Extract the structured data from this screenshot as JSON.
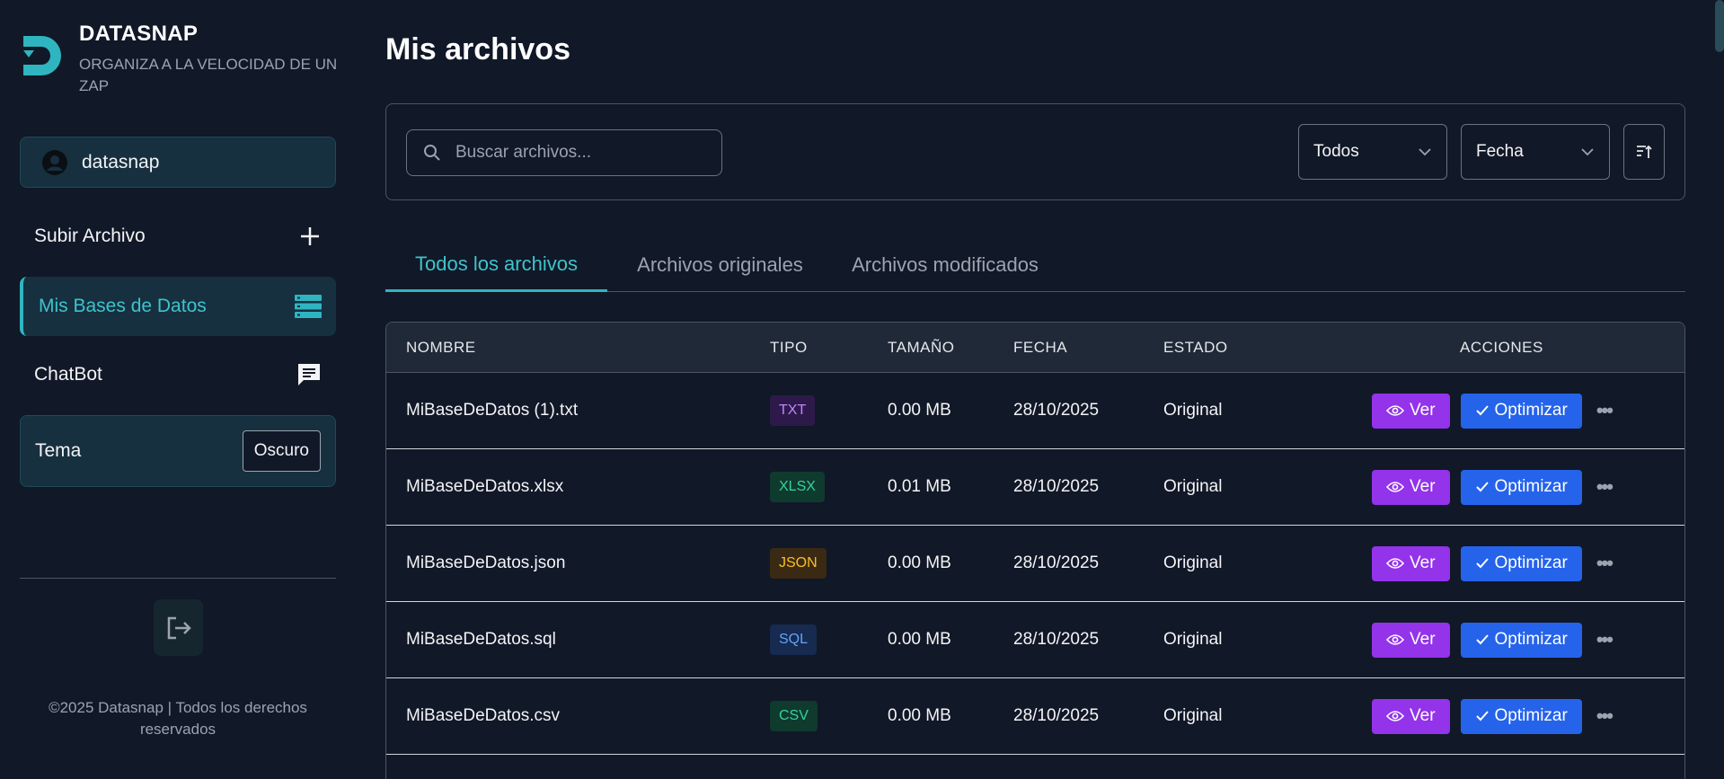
{
  "brand": {
    "name": "DATASNAP",
    "tagline": "ORGANIZA A LA VELOCIDAD DE UN ZAP"
  },
  "user": {
    "name": "datasnap"
  },
  "nav": {
    "upload": "Subir Archivo",
    "databases": "Mis Bases de Datos",
    "chatbot": "ChatBot"
  },
  "theme": {
    "label": "Tema",
    "value": "Oscuro"
  },
  "footer": "©2025 Datasnap | Todos los derechos reservados",
  "main": {
    "title": "Mis archivos",
    "search_placeholder": "Buscar archivos...",
    "filter_type": "Todos",
    "sort_by": "Fecha",
    "tabs": [
      "Todos los archivos",
      "Archivos originales",
      "Archivos modificados"
    ]
  },
  "table": {
    "headers": [
      "NOMBRE",
      "TIPO",
      "TAMAÑO",
      "FECHA",
      "ESTADO",
      "ACCIONES"
    ],
    "view_label": "Ver",
    "optimize_label": "Optimizar",
    "more_label": "•••",
    "rows": [
      {
        "name": "MiBaseDeDatos (1).txt",
        "type": "TXT",
        "size": "0.00 MB",
        "date": "28/10/2025",
        "state": "Original"
      },
      {
        "name": "MiBaseDeDatos.xlsx",
        "type": "XLSX",
        "size": "0.01 MB",
        "date": "28/10/2025",
        "state": "Original"
      },
      {
        "name": "MiBaseDeDatos.json",
        "type": "JSON",
        "size": "0.00 MB",
        "date": "28/10/2025",
        "state": "Original"
      },
      {
        "name": "MiBaseDeDatos.sql",
        "type": "SQL",
        "size": "0.00 MB",
        "date": "28/10/2025",
        "state": "Original"
      },
      {
        "name": "MiBaseDeDatos.csv",
        "type": "CSV",
        "size": "0.00 MB",
        "date": "28/10/2025",
        "state": "Original"
      }
    ]
  },
  "colors": {
    "accent": "#2fb5c0",
    "txt": {
      "fg": "#c084fc",
      "bg": "#2e1a4a"
    },
    "xlsx": {
      "fg": "#34d399",
      "bg": "#0f3a2e"
    },
    "json": {
      "fg": "#fbbf24",
      "bg": "#3a2a14"
    },
    "sql": {
      "fg": "#60a5fa",
      "bg": "#172a4f"
    },
    "csv": {
      "fg": "#34d399",
      "bg": "#0f3a2e"
    }
  }
}
